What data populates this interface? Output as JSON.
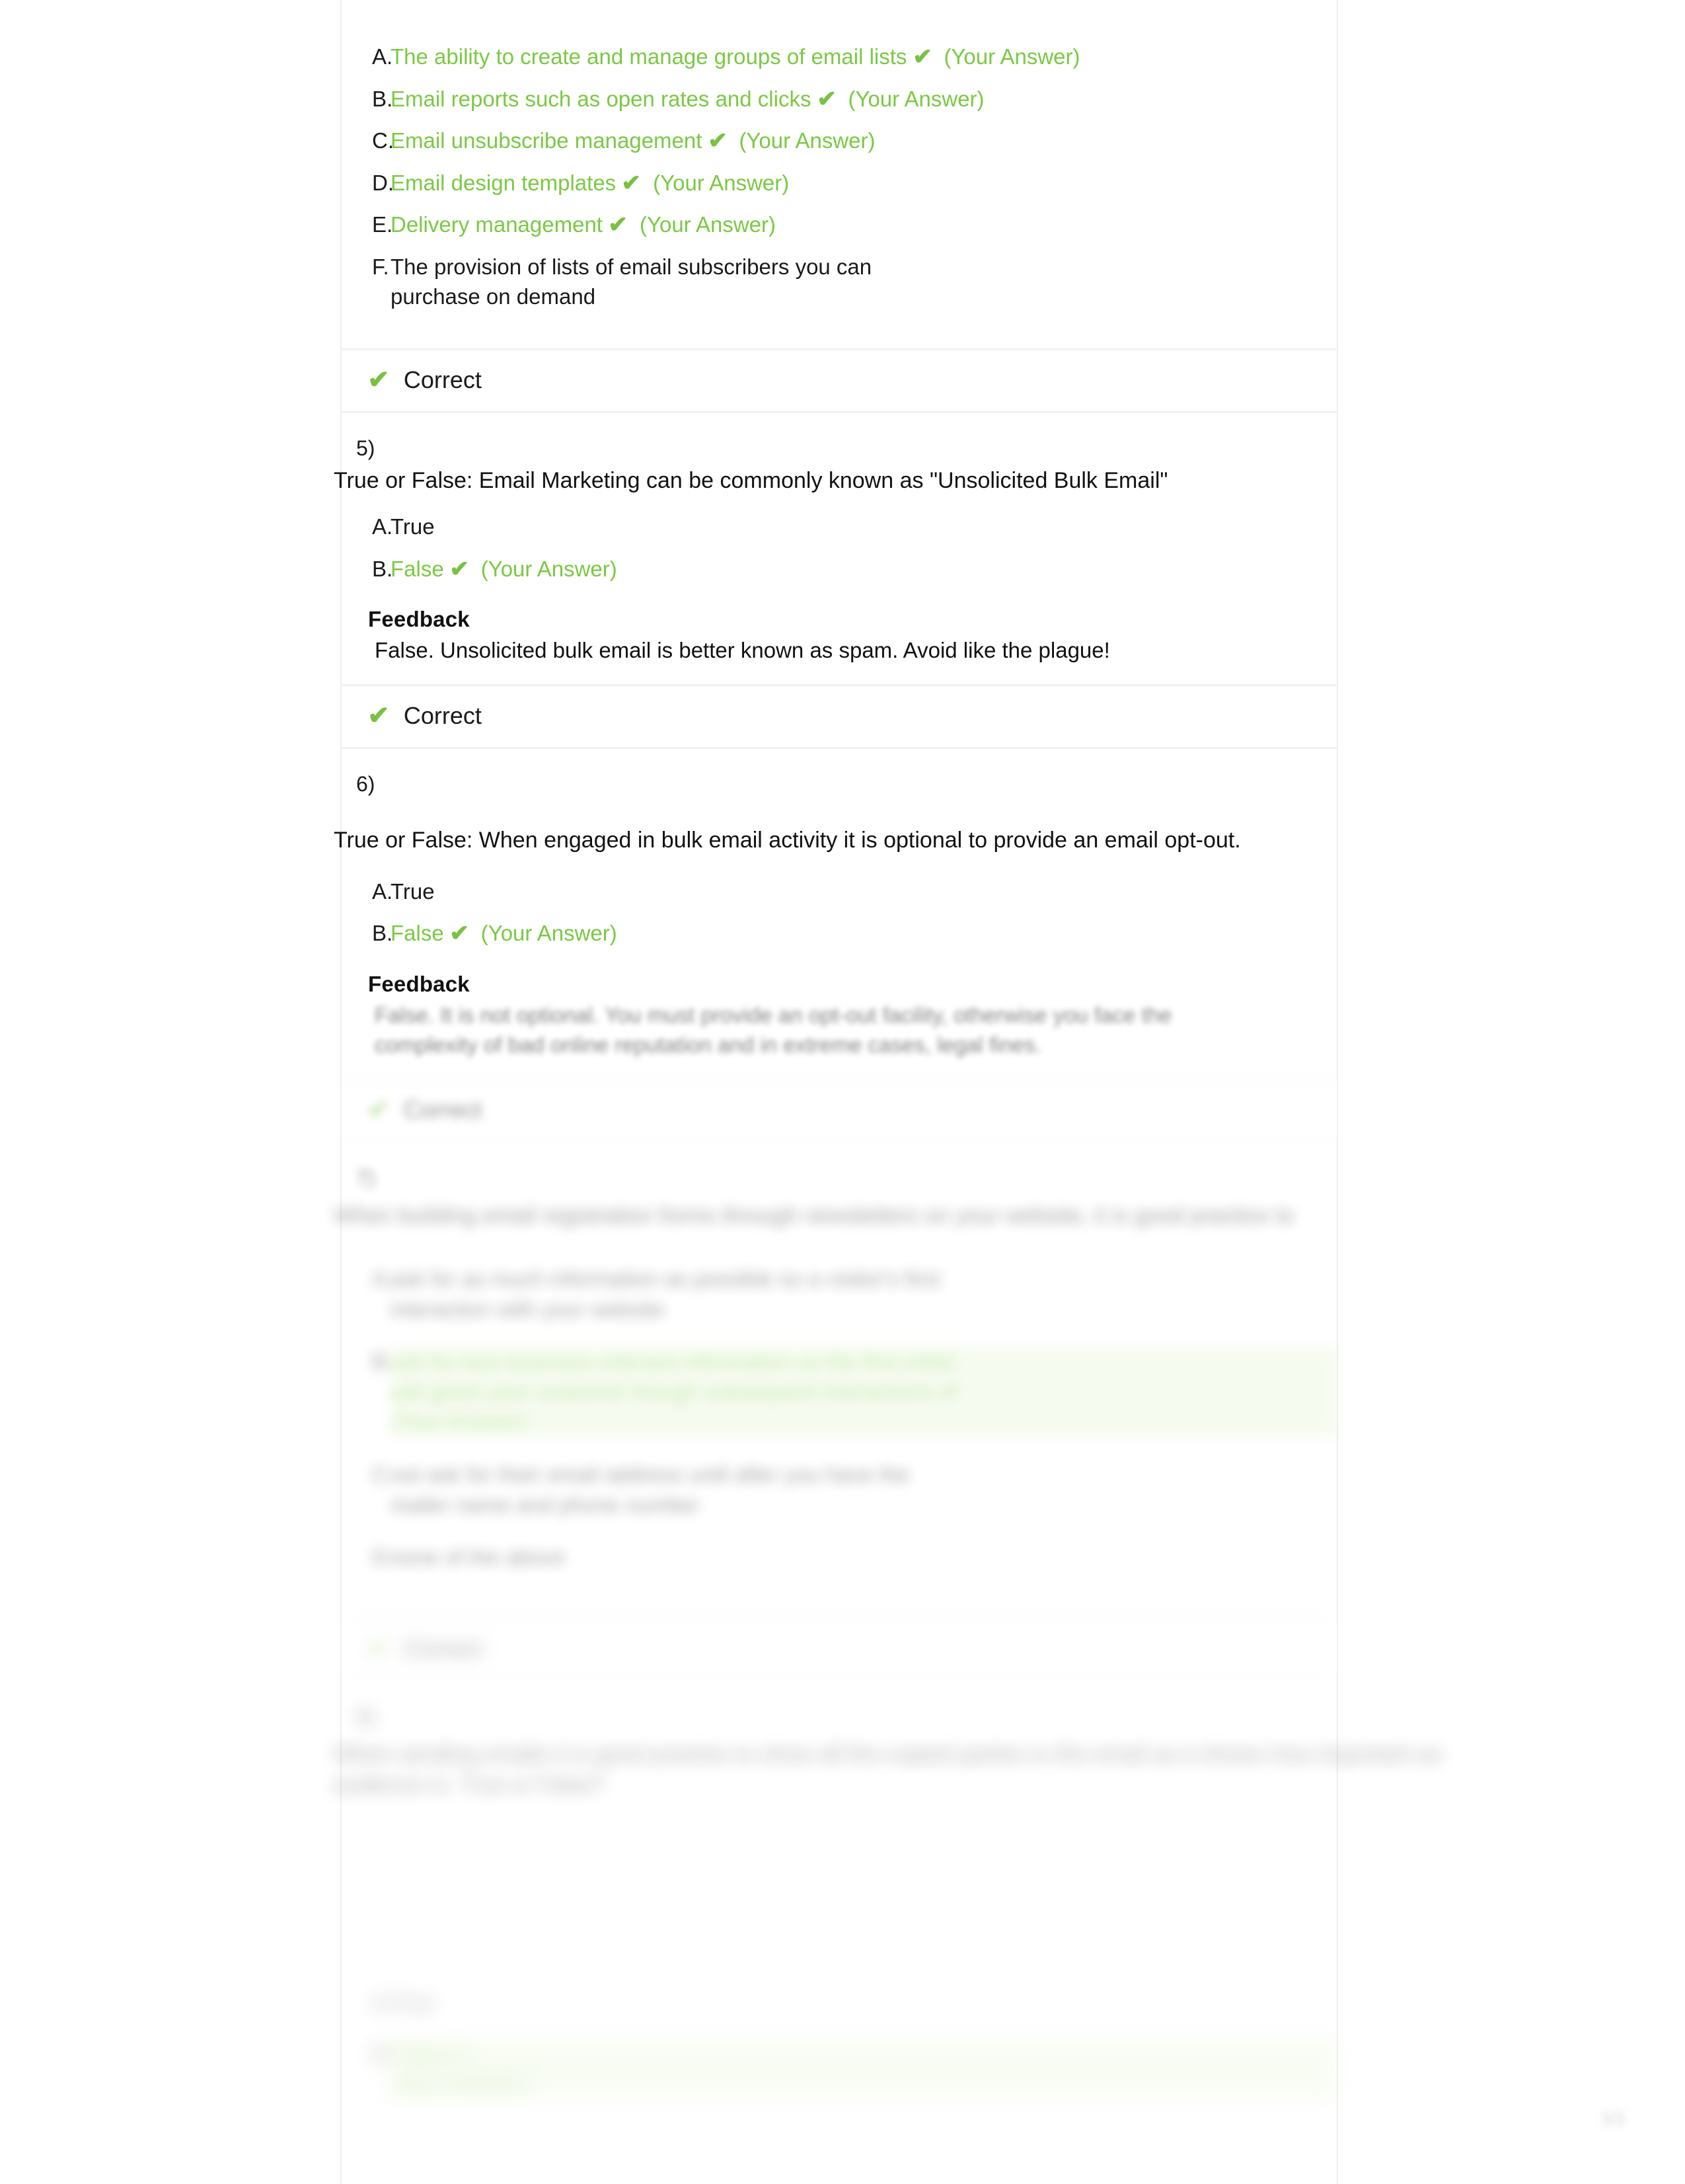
{
  "document": {
    "type": "quiz-review",
    "page_number": "1/1"
  },
  "icons": {
    "check": "✔",
    "check_name": "check-icon"
  },
  "colors": {
    "correct_green": "#7ac943",
    "check_green": "#79c143",
    "text_black": "#111111",
    "divider_gray": "#f1f1f1",
    "border_gray": "#efefef",
    "highlight_green": "#e9f7da"
  },
  "labels": {
    "your_answer": "(Your Answer)",
    "feedback_heading": "Feedback",
    "correct_status": "Correct"
  },
  "questions": [
    {
      "id": "q4",
      "number": "",
      "stem": "",
      "options": [
        {
          "letter": "A.",
          "text": "The ability to create and manage groups of email lists",
          "chosen": true
        },
        {
          "letter": "B.",
          "text": "Email reports such as open rates and clicks",
          "chosen": true
        },
        {
          "letter": "C.",
          "text": "Email unsubscribe management",
          "chosen": true
        },
        {
          "letter": "D.",
          "text": "Email design templates",
          "chosen": true
        },
        {
          "letter": "E.",
          "text": "Delivery management",
          "chosen": true
        },
        {
          "letter": "F.",
          "text": "The provision of lists of email subscribers you can purchase on demand",
          "chosen": false
        }
      ],
      "status": "Correct"
    },
    {
      "id": "q5",
      "number": "5)",
      "stem": "True or False: Email Marketing can be commonly known as \"Unsolicited Bulk Email\"",
      "options": [
        {
          "letter": "A.",
          "text": "True",
          "chosen": false
        },
        {
          "letter": "B.",
          "text": "False",
          "chosen": true
        }
      ],
      "feedback": {
        "heading": "Feedback",
        "body": "False. Unsolicited bulk email is better known as spam. Avoid like the plague!"
      },
      "status": "Correct"
    },
    {
      "id": "q6",
      "number": "6)",
      "stem": "True or False: When engaged in bulk email activity it is optional to provide an email opt-out.",
      "options": [
        {
          "letter": "A.",
          "text": "True",
          "chosen": false
        },
        {
          "letter": "B.",
          "text": "False",
          "chosen": true
        }
      ],
      "feedback": {
        "heading": "Feedback",
        "body": "False. It is not optional. You must provide an opt-out facility, otherwise you face the complexity of bad online reputation and in extreme cases, legal fines."
      },
      "status": "Correct"
    },
    {
      "id": "q7",
      "number": "7)",
      "stem": "When building email registration forms through newsletters on your website, it is good practice to",
      "options": [
        {
          "letter": "A.",
          "text": "ask for as much information as possible so a visitor's first interaction with your website",
          "chosen": false
        },
        {
          "letter": "B.",
          "text": "ask for less business-relevant information so the first initial ask gives your customer though subsequent interactions",
          "chosen": true
        },
        {
          "letter": "C.",
          "text": "not ask for their email address until after you have the mailer name and phone number",
          "chosen": false
        },
        {
          "letter": "D.",
          "text": "none of the above",
          "chosen": false
        }
      ],
      "status": "Correct"
    },
    {
      "id": "q8",
      "number": "8)",
      "stem": "When sending emails it is good practice to show all the copied parties in the email as it shows how important an audience is. True or False?",
      "options": [
        {
          "letter": "A.",
          "text": "True",
          "chosen": false
        },
        {
          "letter": "B.",
          "text": "False",
          "chosen": true
        }
      ],
      "status": ""
    }
  ]
}
